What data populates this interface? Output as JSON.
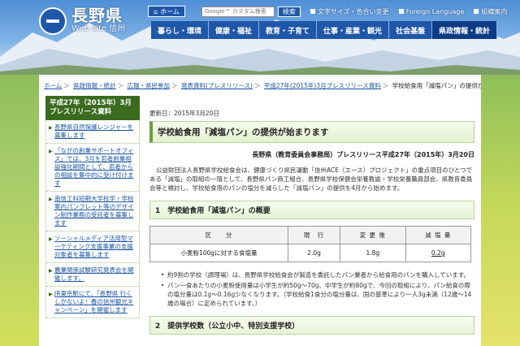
{
  "header": {
    "logo_title": "長野県",
    "logo_subtitle": "Web site 信州",
    "home": "ホーム",
    "search_placeholder": "Google™ カスタム検索",
    "search_button": "検索",
    "font_size_link": "文字サイズ・色合い変更",
    "foreign_language_link": "Foreign Language",
    "org_chart_link": "組織案内"
  },
  "global_nav": [
    "暮らし・環境",
    "健康・福祉",
    "教育・子育て",
    "仕事・産業・観光",
    "社会基盤",
    "県政情報・統計"
  ],
  "breadcrumb": [
    "ホーム",
    "県政情報・統計",
    "広報・県民参加",
    "発表資料(プレスリリース)",
    "平成27年(2015年)3月プレスリリース資料",
    "学校給食用「減塩パン」の提供が始まります"
  ],
  "sidebar": {
    "heading": "平成27年（2015年）3月プレスリリース資料",
    "items": [
      "長野県自然保護レンジャーを募集します",
      "「ながの創業サポートオフィス」では、3月を若者創業相談強化期間として、若者からの相談を集中的に受け付けます",
      "南信工科短期大学校学・学校案内パンフレット等のデザイン制作業務の受託者を募集します",
      "ソーシャルメディア活用型マーケティング支援事業の支援対象者を募集します",
      "農業関係試験研究発表会を開催します。",
      "JR東京駅にて、「長野県 行くしかないよ！春の信州観光キャンペーン」を開催します"
    ]
  },
  "main": {
    "update_date": "更新日：2015年3月20日",
    "title": "学校給食用「減塩パン」の提供が始まります",
    "release_info": "長野県（教育委員会事務局）プレスリリース平成27年（2015年）3月20日",
    "intro": "公益財団法人長野県学校給食会は、健康づくり県民運動「信州ACE（エース）プロジェクト」の重点項目のひとつである「減塩」の取組の一環として、長野県パン商工組合、長野県学校保健会栄養教諭・学校栄養職員部会、県教育委員会等と検討し、学校給食用のパンの塩分を減らした「減塩パン」の提供を4月から始めます。",
    "section1_title": "1　学校給食用「減塩パン」の概要",
    "table": {
      "headers": [
        "区　　分",
        "現　行",
        "変 更 後",
        "減 塩 量"
      ],
      "rows": [
        [
          "小麦粉100gに対する食塩量",
          "2.0g",
          "1.8g",
          "0.2g"
        ]
      ]
    },
    "bullets": [
      "約9割の学校（調理場）は、長野県学校給食会が製造を委託したパン業者から給食用のパンを購入しています。",
      "パン一食あたりの小麦粉使用量は小学生が約50g〜70g、中学生が約80gで、今回の取組により、パン給食の際の塩分量は0.1g〜0.16g少なくなります。（学校給食1食分の塩分量は、国の基準により一人3g未満（12歳〜14歳の場合）に定められています。）"
    ],
    "section2_title": "2　提供学校数（公立小中、特別支援学校）"
  }
}
